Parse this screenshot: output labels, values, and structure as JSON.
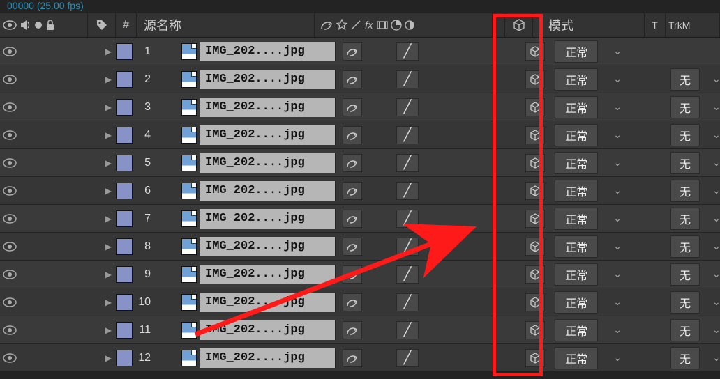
{
  "top_info": "00000 (25.00 fps)",
  "header": {
    "source_name": "源名称",
    "mode": "模式",
    "T": "T",
    "trk": "TrkM",
    "num_symbol": "#"
  },
  "common": {
    "mode_label": "正常",
    "trk_label": "无"
  },
  "layers": [
    {
      "num": "1",
      "name": "IMG_202....jpg",
      "showTrk": false
    },
    {
      "num": "2",
      "name": "IMG_202....jpg",
      "showTrk": true
    },
    {
      "num": "3",
      "name": "IMG_202....jpg",
      "showTrk": true
    },
    {
      "num": "4",
      "name": "IMG_202....jpg",
      "showTrk": true
    },
    {
      "num": "5",
      "name": "IMG_202....jpg",
      "showTrk": true
    },
    {
      "num": "6",
      "name": "IMG_202....jpg",
      "showTrk": true
    },
    {
      "num": "7",
      "name": "IMG_202....jpg",
      "showTrk": true
    },
    {
      "num": "8",
      "name": "IMG_202....jpg",
      "showTrk": true
    },
    {
      "num": "9",
      "name": "IMG_202....jpg",
      "showTrk": true
    },
    {
      "num": "10",
      "name": "IMG_202....jpg",
      "showTrk": true
    },
    {
      "num": "11",
      "name": "IMG_202....jpg",
      "showTrk": true
    },
    {
      "num": "12",
      "name": "IMG_202....jpg",
      "showTrk": true
    }
  ]
}
